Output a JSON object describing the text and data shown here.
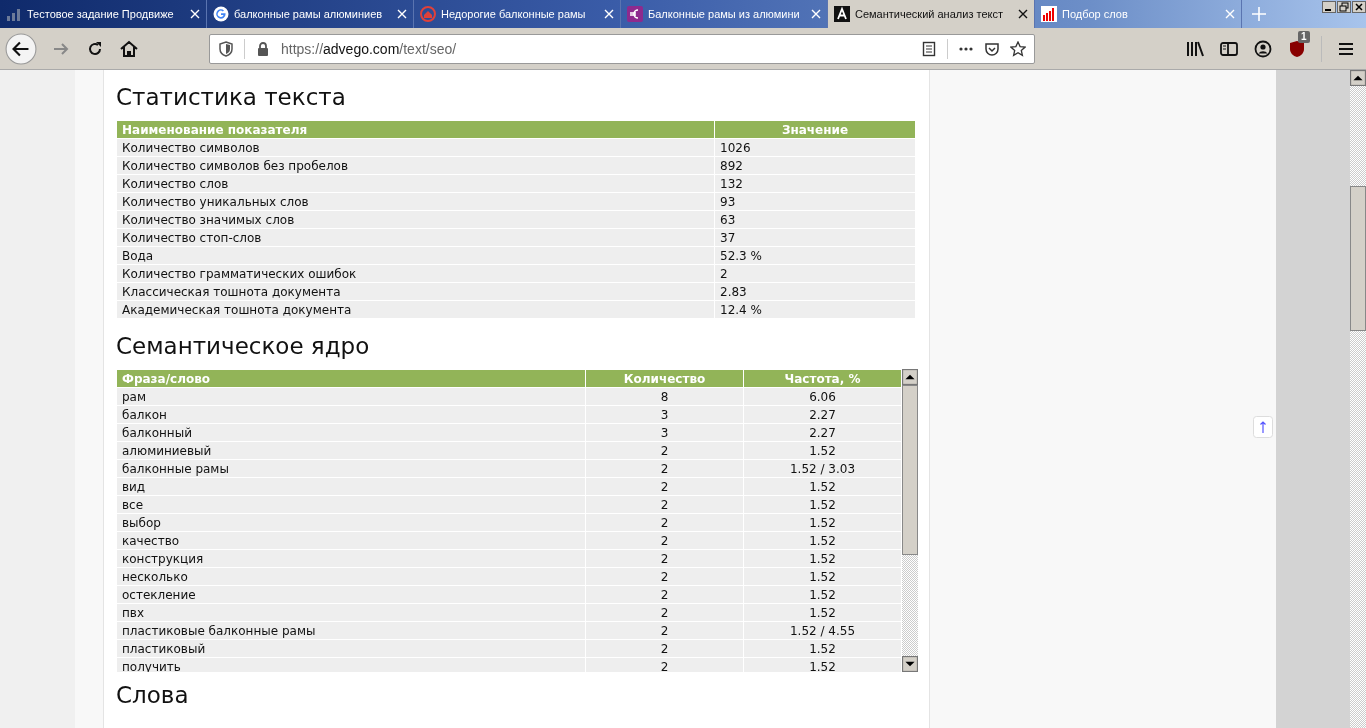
{
  "tabs": [
    {
      "title": "Тестовое задание Продвиже",
      "selected": false
    },
    {
      "title": "балконные рамы алюминиев",
      "selected": false
    },
    {
      "title": "Недорогие балконные рамы",
      "selected": false
    },
    {
      "title": "Балконные рамы из алюмини",
      "selected": false
    },
    {
      "title": "Семантический анализ текст",
      "selected": true
    },
    {
      "title": "Подбор слов",
      "selected": false
    }
  ],
  "address": {
    "scheme": "https://",
    "domain": "advego.com",
    "path": "/text/seo/"
  },
  "extension_badge": "1",
  "stats": {
    "title": "Статистика текста",
    "columns": [
      "Наименование показателя",
      "Значение"
    ],
    "rows": [
      [
        "Количество символов",
        "1026"
      ],
      [
        "Количество символов без пробелов",
        "892"
      ],
      [
        "Количество слов",
        "132"
      ],
      [
        "Количество уникальных слов",
        "93"
      ],
      [
        "Количество значимых слов",
        "63"
      ],
      [
        "Количество стоп-слов",
        "37"
      ],
      [
        "Вода",
        "52.3 %"
      ],
      [
        "Количество грамматических ошибок",
        "2"
      ],
      [
        "Классическая тошнота документа",
        "2.83"
      ],
      [
        "Академическая тошнота документа",
        "12.4 %"
      ]
    ]
  },
  "core": {
    "title": "Семантическое ядро",
    "columns": [
      "Фраза/слово",
      "Количество",
      "Частота, %"
    ],
    "rows": [
      [
        "рам",
        "8",
        "6.06"
      ],
      [
        "балкон",
        "3",
        "2.27"
      ],
      [
        "балконный",
        "3",
        "2.27"
      ],
      [
        "алюминиевый",
        "2",
        "1.52"
      ],
      [
        "балконные рамы",
        "2",
        "1.52 / 3.03"
      ],
      [
        "вид",
        "2",
        "1.52"
      ],
      [
        "все",
        "2",
        "1.52"
      ],
      [
        "выбор",
        "2",
        "1.52"
      ],
      [
        "качество",
        "2",
        "1.52"
      ],
      [
        "конструкция",
        "2",
        "1.52"
      ],
      [
        "несколько",
        "2",
        "1.52"
      ],
      [
        "остекление",
        "2",
        "1.52"
      ],
      [
        "пвх",
        "2",
        "1.52"
      ],
      [
        "пластиковые балконные рамы",
        "2",
        "1.52 / 4.55"
      ],
      [
        "пластиковый",
        "2",
        "1.52"
      ],
      [
        "получить",
        "2",
        "1.52"
      ]
    ]
  },
  "words_title": "Слова"
}
